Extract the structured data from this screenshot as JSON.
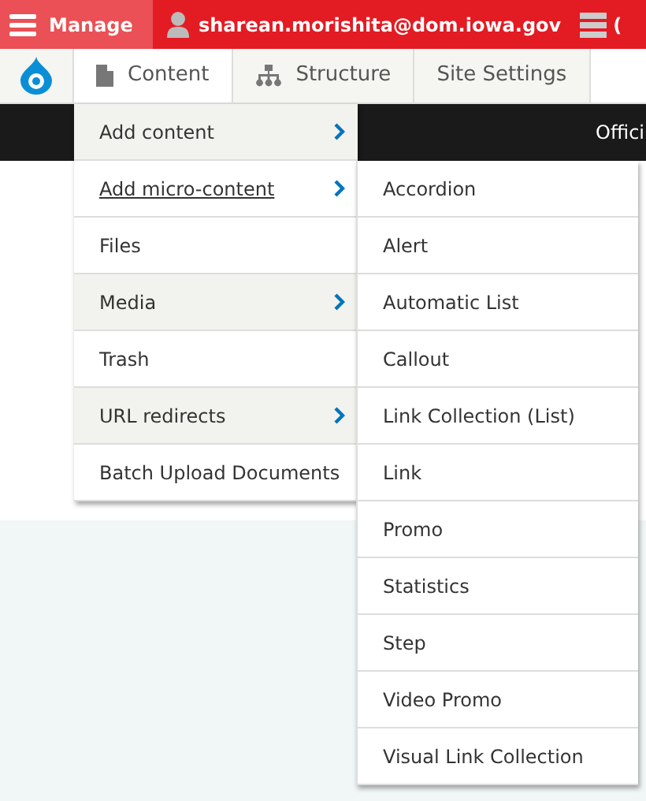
{
  "toolbar": {
    "manage": "Manage",
    "user": "sharean.morishita@dom.iowa.gov",
    "extra": "("
  },
  "tabs": [
    {
      "label": "Content",
      "selected": true,
      "kind": "page"
    },
    {
      "label": "Structure",
      "selected": false,
      "kind": "tree"
    },
    {
      "label": "Site Settings",
      "selected": false,
      "kind": "plain"
    }
  ],
  "page": {
    "banner": "Offici"
  },
  "content_menu": [
    {
      "label": "Add content",
      "submenu": true,
      "hovered": false
    },
    {
      "label": "Add micro-content",
      "submenu": true,
      "hovered": true
    },
    {
      "label": "Files",
      "submenu": false,
      "hovered": false
    },
    {
      "label": "Media",
      "submenu": true,
      "hovered": false
    },
    {
      "label": "Trash",
      "submenu": false,
      "hovered": false
    },
    {
      "label": "URL redirects",
      "submenu": true,
      "hovered": false
    },
    {
      "label": "Batch Upload Documents",
      "submenu": false,
      "hovered": false
    }
  ],
  "micro_content_menu": [
    "Accordion",
    "Alert",
    "Automatic List",
    "Callout",
    "Link Collection (List)",
    "Link",
    "Promo",
    "Statistics",
    "Step",
    "Video Promo",
    "Visual Link Collection"
  ]
}
